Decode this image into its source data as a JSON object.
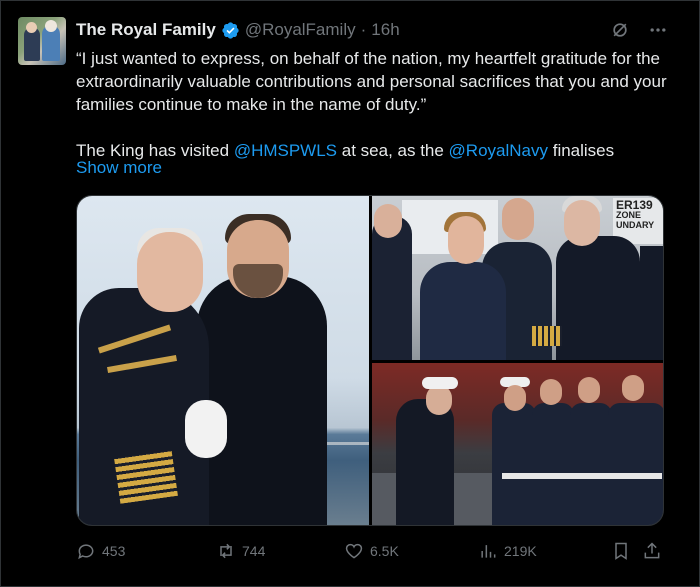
{
  "tweet": {
    "author_name": "The Royal Family",
    "handle": "@RoyalFamily",
    "separator": "·",
    "time": "16h",
    "text_line": "“I just wanted to express, on behalf of the nation, my heartfelt gratitude for the extraordinarily valuable contributions and personal sacrifices that you and your families continue to make in the name of duty.”",
    "para2_pre": "The King has visited ",
    "mention1": "@HMSPWLS",
    "para2_mid": " at sea, as the ",
    "mention2": "@RoyalNavy",
    "para2_post": " finalises",
    "show_more": "Show more"
  },
  "media": {
    "sign_line1": "ER139",
    "sign_line2": "ZONE",
    "sign_line3": "UNDARY"
  },
  "actions": {
    "replies": "453",
    "reposts": "744",
    "likes": "6.5K",
    "views": "219K"
  },
  "icons": {
    "verified": "verified-badge-icon",
    "grok": "grok-icon",
    "more": "more-icon",
    "reply": "reply-icon",
    "repost": "repost-icon",
    "like": "like-icon",
    "views": "views-icon",
    "bookmark": "bookmark-icon",
    "share": "share-icon"
  },
  "colors": {
    "background": "#000000",
    "text": "#e7e9ea",
    "muted": "#71767b",
    "link": "#1d9bf0",
    "verified": "#1d9bf0"
  }
}
